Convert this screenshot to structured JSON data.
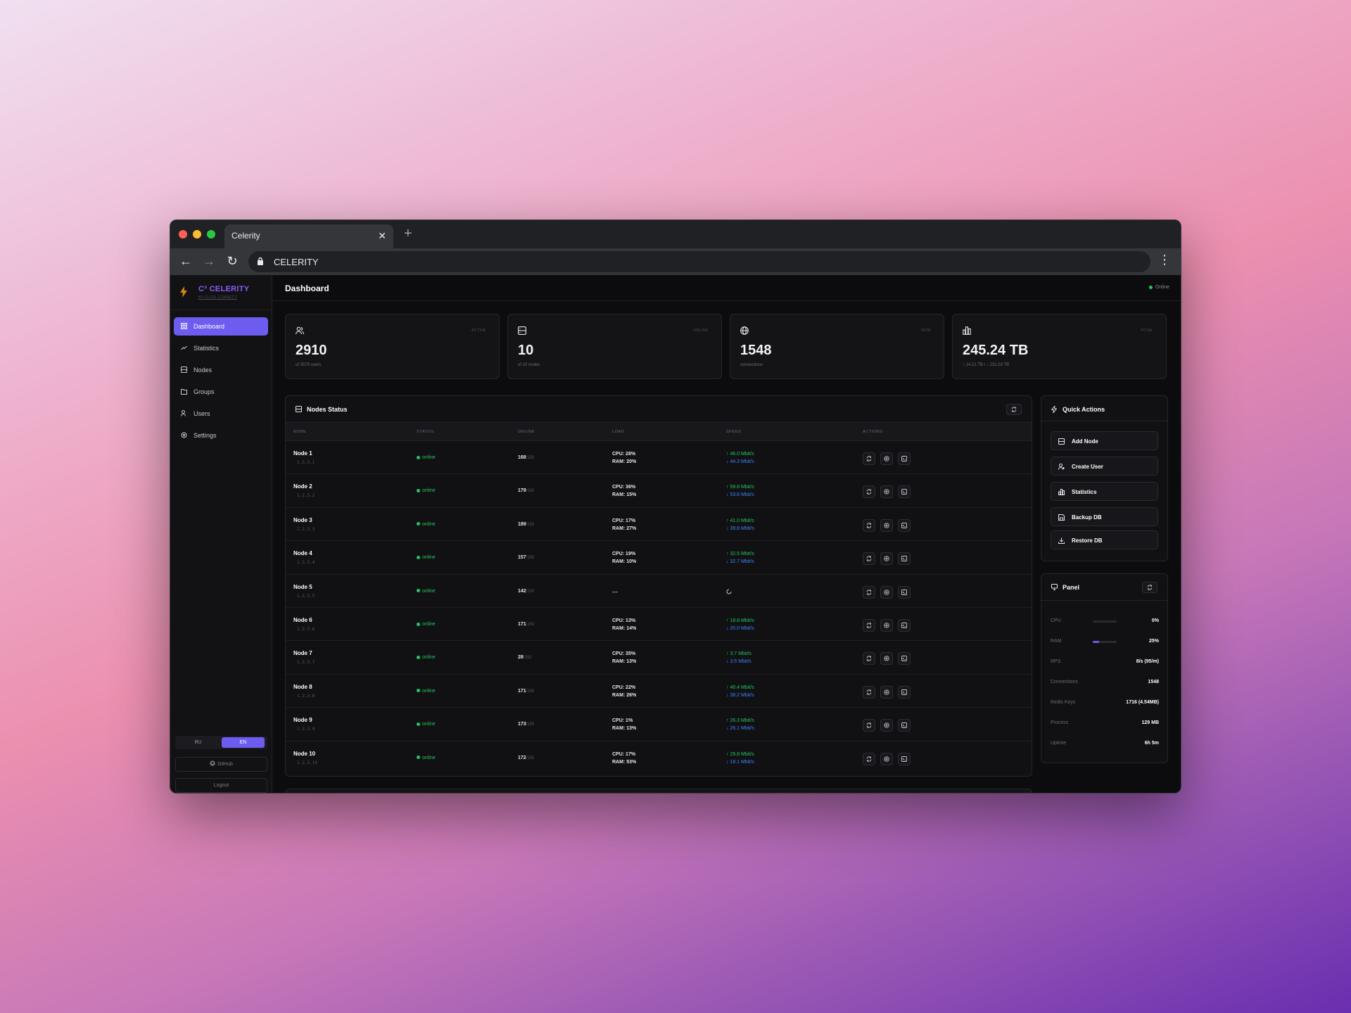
{
  "browser": {
    "tab_title": "Celerity",
    "url": "CELERITY"
  },
  "brand": {
    "title": "C³ CELERITY",
    "subtitle": "BY CLICK CONNECT"
  },
  "sidebar": {
    "items": [
      {
        "label": "Dashboard",
        "icon": "grid-icon",
        "active": true
      },
      {
        "label": "Statistics",
        "icon": "trend-icon"
      },
      {
        "label": "Nodes",
        "icon": "server-icon"
      },
      {
        "label": "Groups",
        "icon": "folder-icon"
      },
      {
        "label": "Users",
        "icon": "users-icon"
      },
      {
        "label": "Settings",
        "icon": "gear-icon"
      }
    ],
    "lang": {
      "ru": "RU",
      "en": "EN",
      "selected": "EN"
    },
    "github": "GitHub",
    "logout": "Logout"
  },
  "header": {
    "title": "Dashboard",
    "status": "Online"
  },
  "stats": [
    {
      "icon": "users-icon",
      "tag": "ACTIVE",
      "value": "2910",
      "sub": "of 3579 users"
    },
    {
      "icon": "server-icon",
      "tag": "ONLINE",
      "value": "10",
      "sub": "of 10 nodes"
    },
    {
      "icon": "globe-icon",
      "tag": "NOW",
      "value": "1548",
      "sub": "connections"
    },
    {
      "icon": "bar-chart-icon",
      "tag": "TOTAL",
      "value": "245.24 TB",
      "sub_up": "14.21 TB",
      "sub_sep": " / ",
      "sub_down": "231.03 TB"
    }
  ],
  "nodes": {
    "title": "Nodes Status",
    "columns": [
      "NODE",
      "STATUS",
      "ONLINE",
      "LOAD",
      "SPEED",
      "ACTIONS"
    ],
    "rows": [
      {
        "name": "Node 1",
        "ip": "1.2.3.1",
        "status": "online",
        "online": "168",
        "max": "/150",
        "cpu": "CPU: 28%",
        "ram": "RAM: 20%",
        "up": "46.0 Mbit/s",
        "down": "44.3 Mbit/s"
      },
      {
        "name": "Node 2",
        "ip": "1.2.3.2",
        "status": "online",
        "online": "179",
        "max": "/150",
        "cpu": "CPU: 36%",
        "ram": "RAM: 15%",
        "up": "59.8 Mbit/s",
        "down": "53.8 Mbit/s"
      },
      {
        "name": "Node 3",
        "ip": "1.2.3.3",
        "status": "online",
        "online": "189",
        "max": "/150",
        "cpu": "CPU: 17%",
        "ram": "RAM: 27%",
        "up": "41.0 Mbit/s",
        "down": "39.8 Mbit/s"
      },
      {
        "name": "Node 4",
        "ip": "1.2.3.4",
        "status": "online",
        "online": "157",
        "max": "/150",
        "cpu": "CPU: 19%",
        "ram": "RAM: 10%",
        "up": "32.5 Mbit/s",
        "down": "32.7 Mbit/s"
      },
      {
        "name": "Node 5",
        "ip": "1.2.3.5",
        "status": "online",
        "online": "142",
        "max": "/100",
        "load_placeholder": "—"
      },
      {
        "name": "Node 6",
        "ip": "1.2.3.6",
        "status": "online",
        "online": "171",
        "max": "/150",
        "cpu": "CPU: 13%",
        "ram": "RAM: 14%",
        "up": "18.8 Mbit/s",
        "down": "20.0 Mbit/s"
      },
      {
        "name": "Node 7",
        "ip": "1.2.3.7",
        "status": "online",
        "online": "28",
        "max": "/150",
        "cpu": "CPU: 35%",
        "ram": "RAM: 13%",
        "up": "3.7 Mbit/s",
        "down": "3.5 Mbit/s"
      },
      {
        "name": "Node 8",
        "ip": "1.2.3.8",
        "status": "online",
        "online": "171",
        "max": "/150",
        "cpu": "CPU: 22%",
        "ram": "RAM: 26%",
        "up": "40.4 Mbit/s",
        "down": "38.2 Mbit/s"
      },
      {
        "name": "Node 9",
        "ip": "1.2.3.9",
        "status": "online",
        "online": "173",
        "max": "/150",
        "cpu": "CPU: 1%",
        "ram": "RAM: 13%",
        "up": "26.3 Mbit/s",
        "down": "26.1 Mbit/s"
      },
      {
        "name": "Node 10",
        "ip": "1.2.3.10",
        "status": "online",
        "online": "172",
        "max": "/150",
        "cpu": "CPU: 17%",
        "ram": "RAM: 53%",
        "up": "29.8 Mbit/s",
        "down": "18.1 Mbit/s"
      }
    ]
  },
  "quick_actions": {
    "title": "Quick Actions",
    "buttons": [
      {
        "label": "Add Node",
        "icon": "server-icon"
      },
      {
        "label": "Create User",
        "icon": "user-plus-icon"
      },
      {
        "label": "Statistics",
        "icon": "bar-chart-icon"
      },
      {
        "label": "Backup DB",
        "icon": "save-icon"
      },
      {
        "label": "Restore DB",
        "icon": "download-icon"
      }
    ]
  },
  "panel": {
    "title": "Panel",
    "rows": [
      {
        "label": "CPU",
        "value": "0%",
        "bar": 0.0
      },
      {
        "label": "RAM",
        "value": "25%",
        "bar": 0.25
      },
      {
        "label": "RPS",
        "value": "8/s (95/m)"
      },
      {
        "label": "Connections",
        "value": "1548"
      },
      {
        "label": "Redis Keys",
        "value": "1716 (4.54MB)"
      },
      {
        "label": "Process",
        "value": "129 MB"
      },
      {
        "label": "Uptime",
        "value": "6h 5m"
      }
    ]
  },
  "colors": {
    "accent": "#6d5cf0",
    "brand": "#8b5cf6",
    "online": "#22c55e",
    "download": "#3b82f6",
    "upload": "#22c55e"
  }
}
